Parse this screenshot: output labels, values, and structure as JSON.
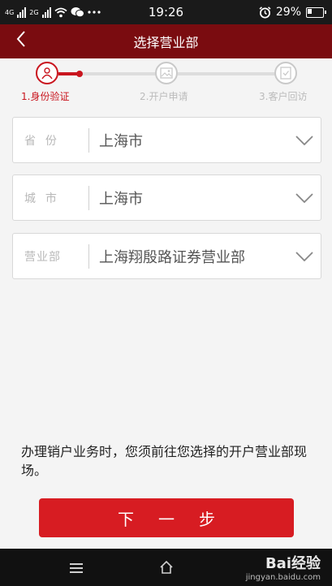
{
  "status_bar": {
    "network_left": "4G",
    "network_right": "2G",
    "time": "19:26",
    "battery": "29%",
    "icons": [
      "signal-icon",
      "wifi-icon",
      "wechat-icon",
      "more-icon",
      "alarm-icon",
      "battery-icon"
    ]
  },
  "nav": {
    "back_icon": "back-chevron-icon",
    "title": "选择营业部"
  },
  "steps": [
    {
      "label": "1.身份验证",
      "icon": "user-icon",
      "active": true
    },
    {
      "label": "2.开户申请",
      "icon": "image-icon",
      "active": false
    },
    {
      "label": "3.客户回访",
      "icon": "checklist-icon",
      "active": false
    }
  ],
  "fields": [
    {
      "label": "省  份",
      "value": "上海市"
    },
    {
      "label": "城  市",
      "value": "上海市"
    },
    {
      "label": "营业部",
      "value": "上海翔殷路证券营业部"
    }
  ],
  "notice": "办理销户业务时，您须前往您选择的开户营业部现场。",
  "next_button": "下一步",
  "bottom_bar": {
    "icons": [
      "menu-icon",
      "home-icon"
    ],
    "watermark_brand": "Bai经验",
    "watermark_url": "jingyan.baidu.com"
  },
  "colors": {
    "nav_bg": "#7a0c10",
    "accent": "#c9151e",
    "button": "#d71c22"
  }
}
